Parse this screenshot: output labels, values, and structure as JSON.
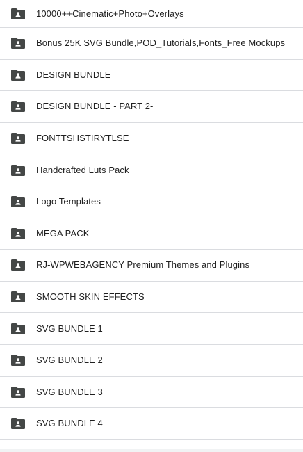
{
  "colors": {
    "folder_icon": "#444746",
    "divider": "#dadce0",
    "text": "#1f1f1f"
  },
  "folder_icon_name": "shared-folder-icon",
  "folders": [
    {
      "name": "10000++Cinematic+Photo+Overlays"
    },
    {
      "name": "Bonus 25K SVG Bundle,POD_Tutorials,Fonts_Free Mockups"
    },
    {
      "name": "DESIGN BUNDLE"
    },
    {
      "name": "DESIGN BUNDLE - PART 2-"
    },
    {
      "name": "FONTTSHSTIRYTLSE"
    },
    {
      "name": "Handcrafted Luts Pack"
    },
    {
      "name": "Logo Templates"
    },
    {
      "name": "MEGA PACK"
    },
    {
      "name": "RJ-WPWEBAGENCY Premium Themes and Plugins"
    },
    {
      "name": "SMOOTH SKIN EFFECTS"
    },
    {
      "name": "SVG BUNDLE 1"
    },
    {
      "name": "SVG BUNDLE 2"
    },
    {
      "name": "SVG BUNDLE 3"
    },
    {
      "name": "SVG BUNDLE 4"
    }
  ]
}
